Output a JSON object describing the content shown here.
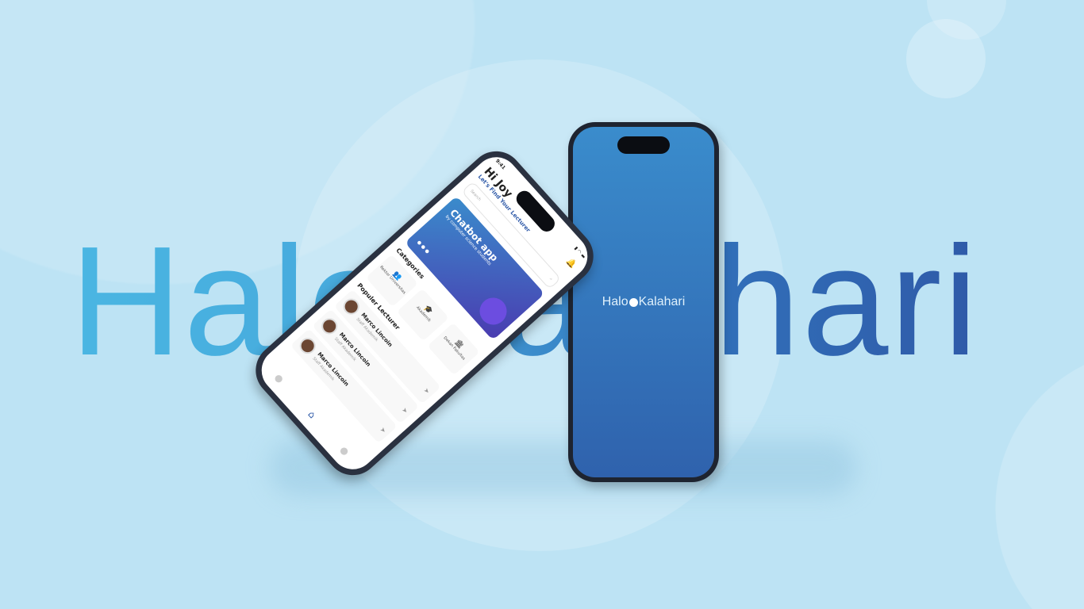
{
  "brand": {
    "word": "HaloKalahari",
    "logo_left": "Halo",
    "logo_right": "Kalahari"
  },
  "app": {
    "time": "9:41",
    "greeting": "Hi Joy",
    "subtitle": "Let's Find Your Lecturer",
    "search_placeholder": "Search",
    "banner": {
      "title": "Chatbot app",
      "subtitle": "by computer science students"
    },
    "categories_title": "Categories",
    "categories": [
      {
        "label": "Rektor Universitas"
      },
      {
        "label": "Akademik"
      },
      {
        "label": "Dekan Fakultas"
      }
    ],
    "popular_title": "Populer Lecturer",
    "lecturers": [
      {
        "name": "Marco Lincoin",
        "role": "Staff Akademik"
      },
      {
        "name": "Marco Lincoin",
        "role": "Staff Akademik"
      },
      {
        "name": "Marco Lincoin",
        "role": "Staff Akademik"
      }
    ]
  }
}
